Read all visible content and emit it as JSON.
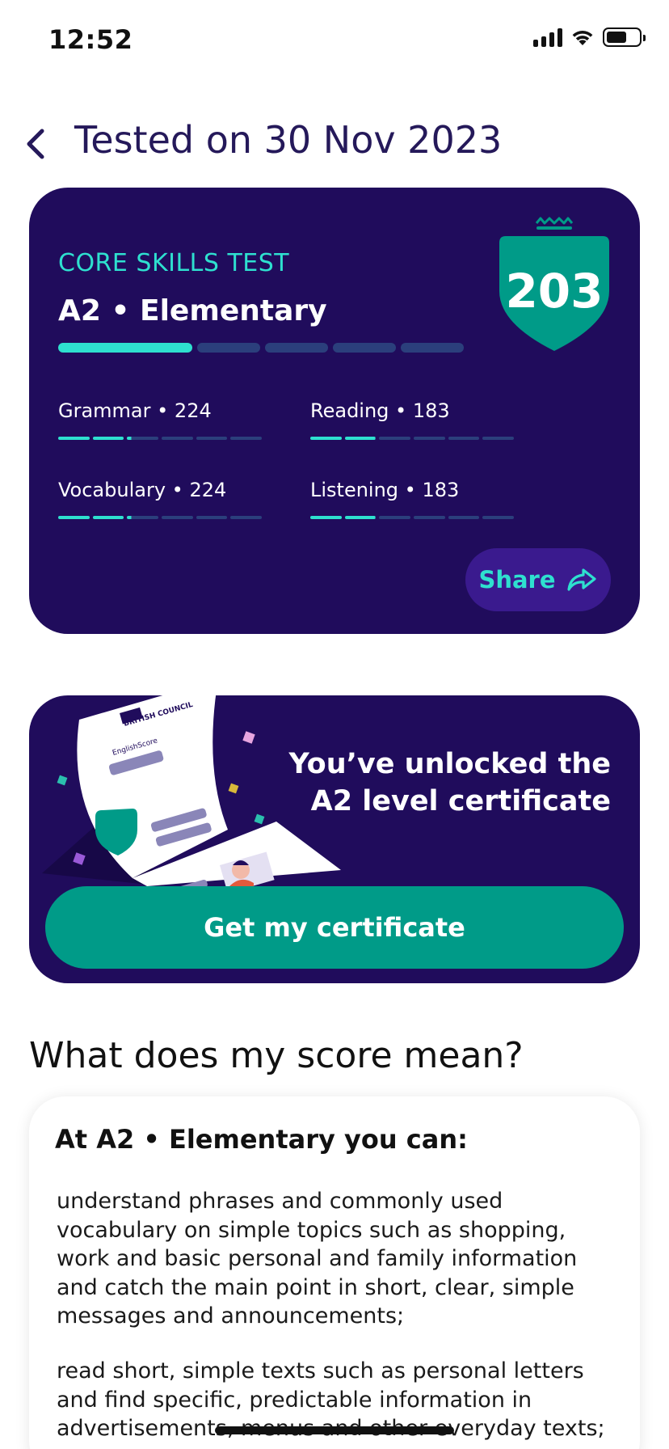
{
  "status_bar": {
    "time": "12:52",
    "icons": [
      "signal-icon",
      "wifi-icon",
      "battery-icon"
    ],
    "battery_level": 0.6
  },
  "header": {
    "back_icon": "chevron-left-icon",
    "title": "Tested on 30 Nov 2023"
  },
  "score_card": {
    "test_name": "CORE SKILLS TEST",
    "level": "A2 • Elementary",
    "score": "203",
    "level_progress": {
      "filled_segments": 1,
      "total_segments": 5
    },
    "skills": {
      "grammar": {
        "label": "Grammar • 224",
        "fill_fraction": 0.36
      },
      "reading": {
        "label": "Reading • 183",
        "fill_fraction": 0.32
      },
      "vocabulary": {
        "label": "Vocabulary • 224",
        "fill_fraction": 0.36
      },
      "listening": {
        "label": "Listening • 183",
        "fill_fraction": 0.32
      }
    },
    "share_label": "Share",
    "share_icon": "share-arrow-icon"
  },
  "certificate": {
    "illustration_brand": "BRITISH COUNCIL",
    "illustration_product": "EnglishScore",
    "message": "You’ve unlocked the A2 level certificate",
    "button_label": "Get my certificate"
  },
  "meaning": {
    "section_title": "What does my score mean?",
    "heading": "At A2 • Elementary you can:",
    "paragraphs": [
      "understand phrases and commonly used vocabulary on simple topics such as shopping, work and basic personal and family information and catch the main point in short, clear, simple messages and announcements;",
      "read short, simple texts such as personal letters and find specific, predictable information in advertisements, menus and other everyday texts;"
    ]
  },
  "colors": {
    "card_bg": "#200c5c",
    "accent_teal": "#2ee0cf",
    "button_teal": "#009b88",
    "title_purple": "#25195a"
  }
}
